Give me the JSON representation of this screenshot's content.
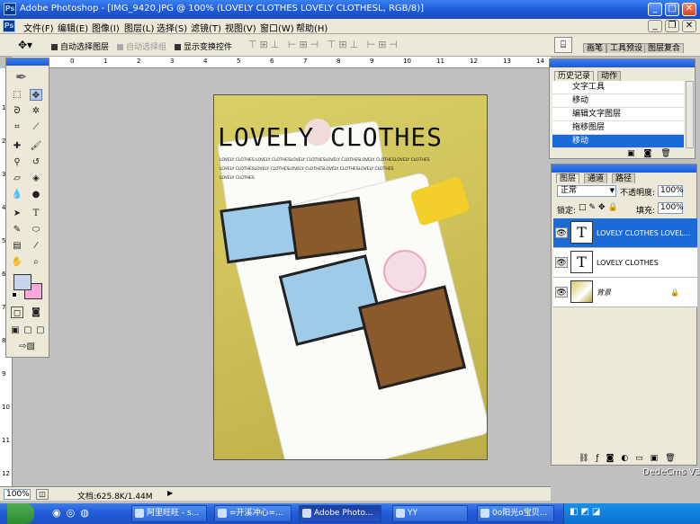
{
  "window": {
    "title": "Adobe Photoshop - [IMG_9420.JPG @ 100% (LOVELY CLOTHES LOVELY CLOTHESL, RGB/8)]",
    "min": "_",
    "max": "□",
    "close": "✕"
  },
  "menu": [
    "文件(F)",
    "编辑(E)",
    "图像(I)",
    "图层(L)",
    "选择(S)",
    "滤镜(T)",
    "视图(V)",
    "窗口(W)",
    "帮助(H)"
  ],
  "options": {
    "auto_select_layer": "自动选择图层",
    "auto_select_group": "自动选择组",
    "show_transform": "显示变换控件",
    "right_tabs": [
      "画笔",
      "工具预设",
      "图层复合"
    ]
  },
  "ruler_top": [
    "0",
    "1",
    "2",
    "3",
    "4",
    "5",
    "6",
    "7",
    "8",
    "9",
    "10",
    "11",
    "12",
    "13",
    "14",
    "15"
  ],
  "ruler_left": [
    "1",
    "2",
    "3",
    "4",
    "5",
    "6",
    "7",
    "8",
    "9",
    "10",
    "11",
    "12"
  ],
  "artwork": {
    "headline": "LOVELY CLOTHES",
    "small_line_1": "LOVELY CLOTHES LOVELY CLOTHESLOVELY CLOTHESLOVELY CLOTHESLOVELY CLOTHESLOVELY CLOTHES",
    "small_line_2": "LOVELY CLOTHESLOVELY CLOTHESLOVELY CLOTHESLOVELY CLOTHESLOVELY CLOTHES",
    "small_line_3": "LOVELY CLOTHES"
  },
  "history": {
    "tabs": [
      "历史记录",
      "动作"
    ],
    "items": [
      "文字工具",
      "移动",
      "编辑文字图层",
      "拖移图层",
      "移动"
    ],
    "selected_index": 4
  },
  "layers": {
    "tabs": [
      "图层",
      "通道",
      "路径"
    ],
    "blend_mode": "正常",
    "opacity_label": "不透明度:",
    "opacity": "100%",
    "lock_label": "锁定:",
    "fill_label": "填充:",
    "fill": "100%",
    "items": [
      {
        "name": "LOVELY CLOTHES LOVEL...",
        "thumb": "T",
        "selected": true
      },
      {
        "name": "LOVELY CLOTHES",
        "thumb": "T",
        "selected": false
      },
      {
        "name": "背景",
        "thumb": "",
        "selected": false
      }
    ]
  },
  "status": {
    "zoom": "100%",
    "doc_info": "文档:625.8K/1.44M"
  },
  "taskbar": {
    "items": [
      "阿里旺旺 - s...",
      "=开溪冲心=...",
      "Adobe Photo...",
      "YY",
      "0o阳光o宝贝..."
    ],
    "active_index": 2
  },
  "watermark": "DedeCms V3",
  "colors": {
    "titlebar": "#245edb",
    "canvas_bg": "#c0c0c0",
    "fg_swatch": "#c8d4ec",
    "bg_swatch": "#f8a8d8",
    "selection": "#1a6ad8"
  }
}
